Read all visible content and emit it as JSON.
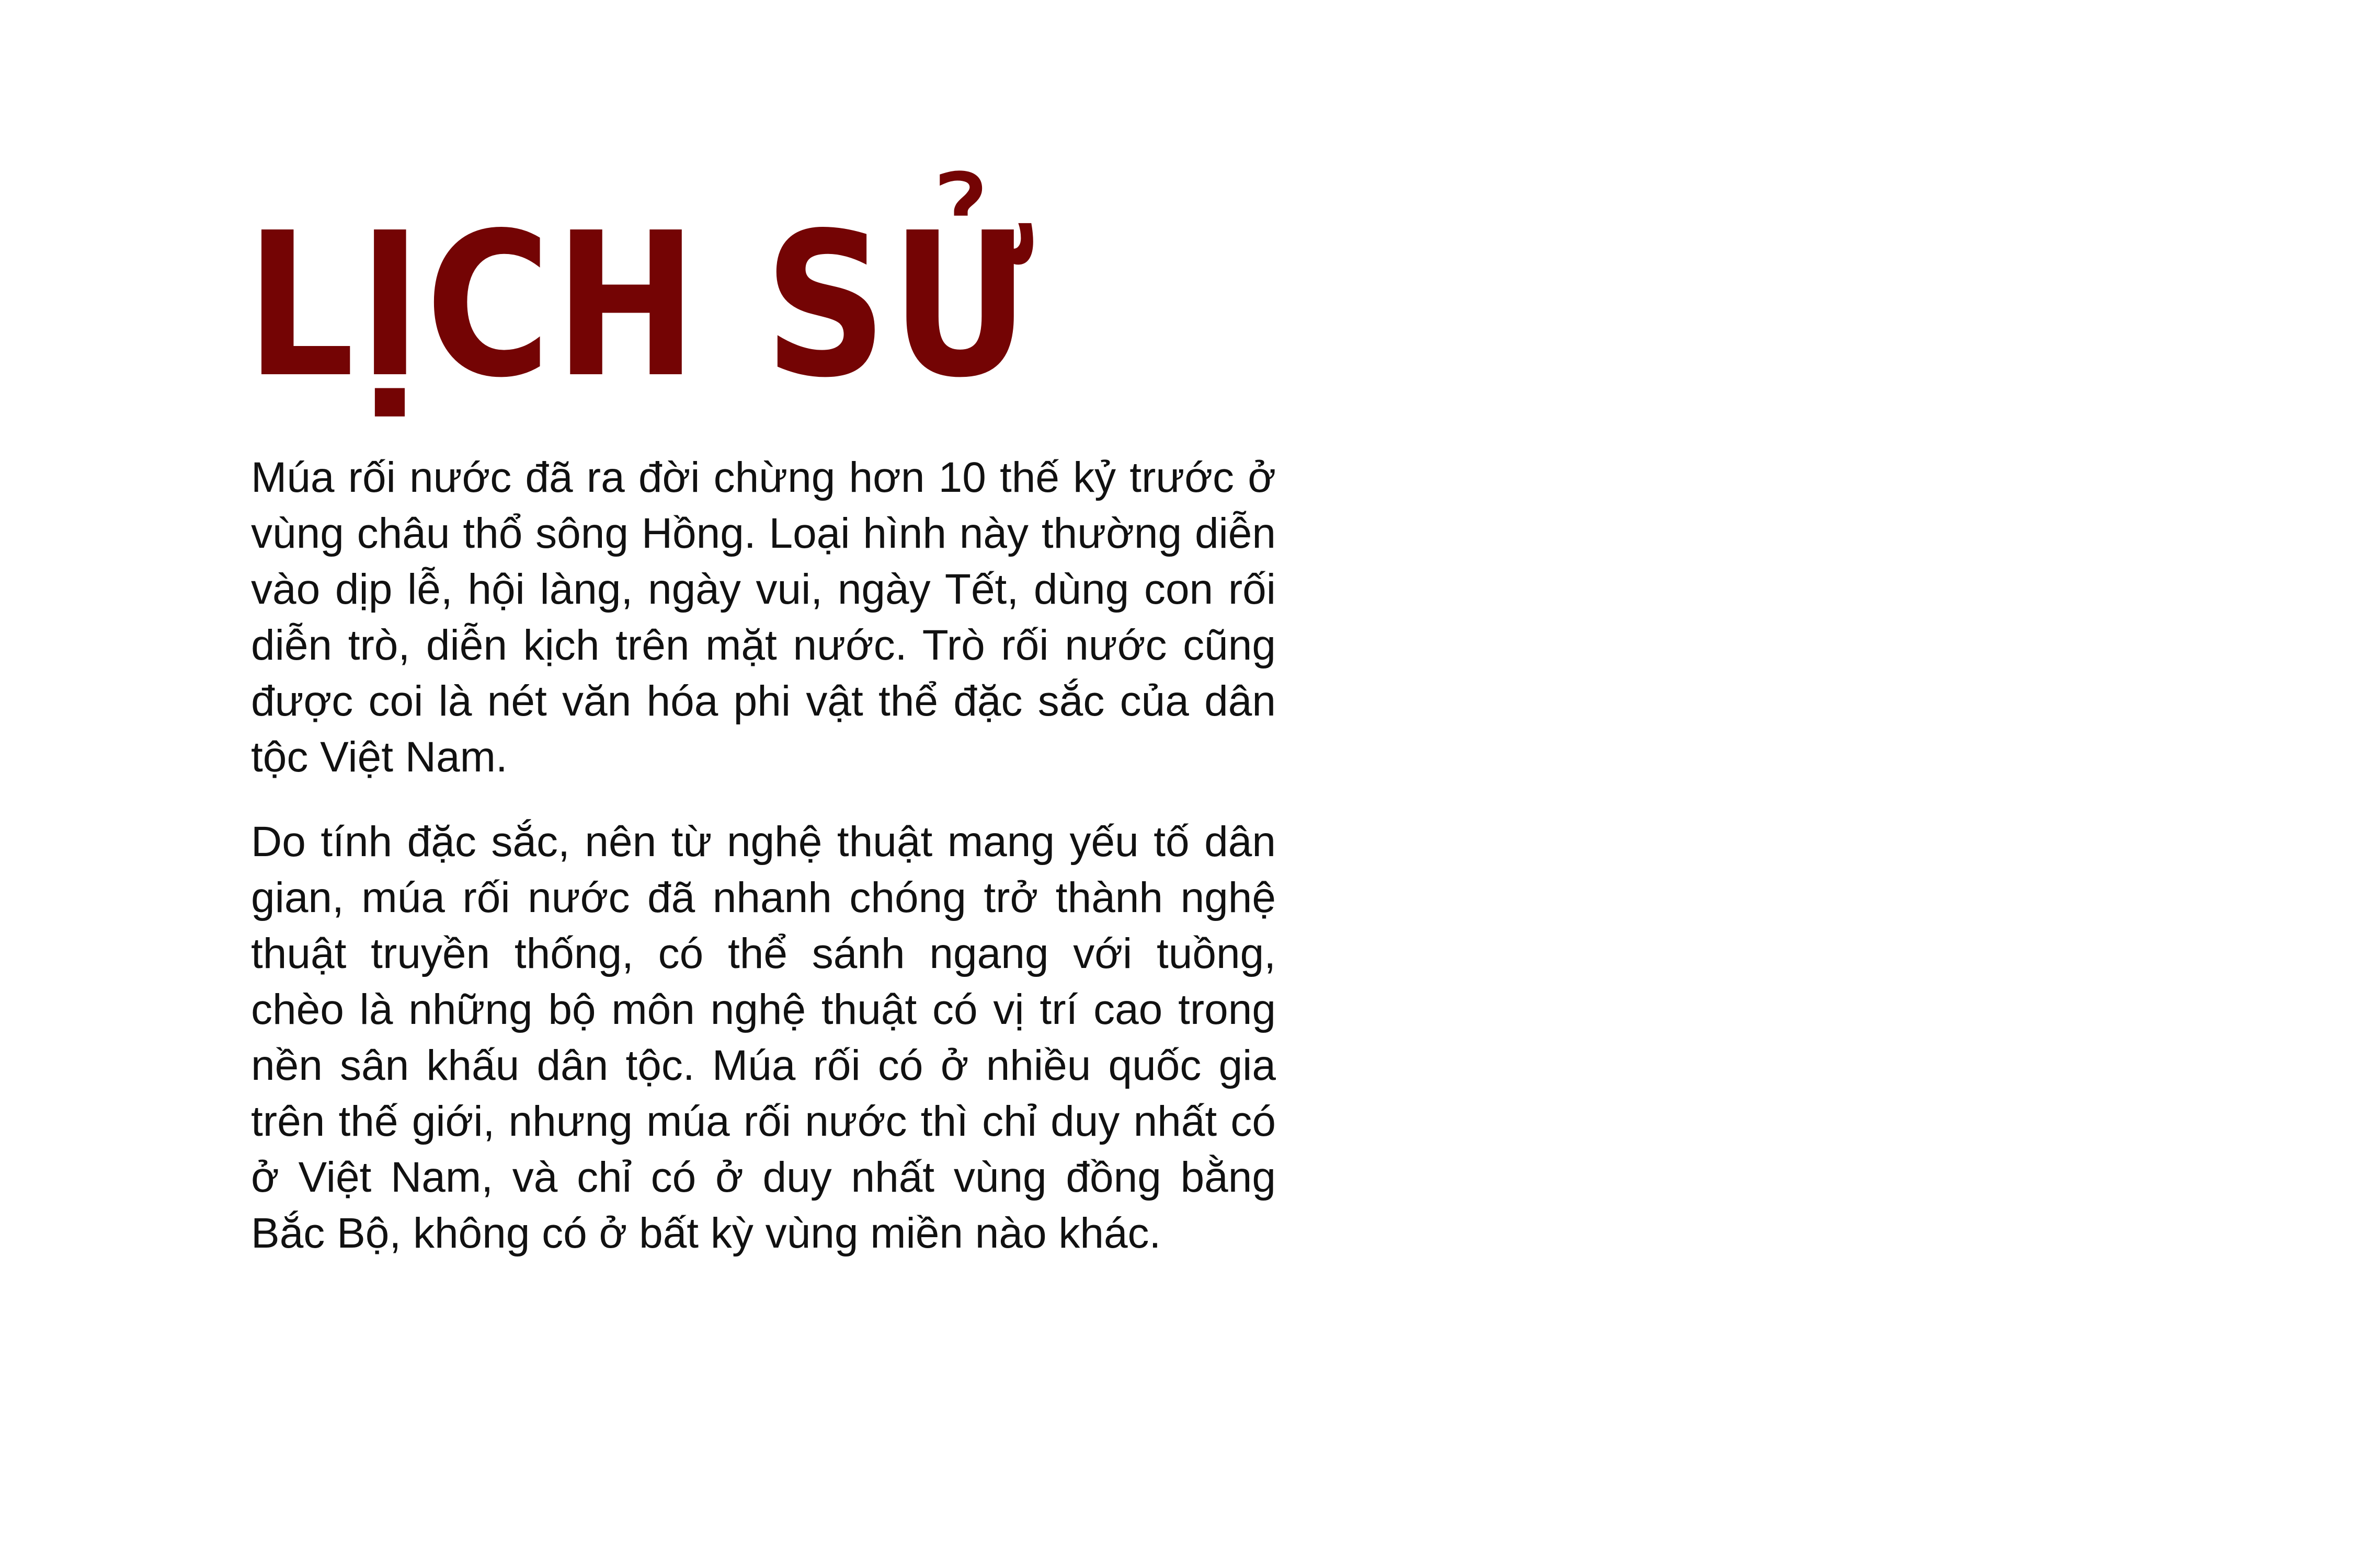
{
  "heading": {
    "title": "LỊCH SỬ"
  },
  "content": {
    "paragraphs": [
      "Múa rối nước đã ra đời chừng hơn 10 thế kỷ trước ở vùng châu thổ sông Hồng. Loại hình này thường diễn vào dịp lễ, hội làng, ngày vui, ngày Tết, dùng con rối diễn trò, diễn kịch trên mặt nước. Trò rối nước cũng được coi là nét văn hóa phi vật thể đặc sắc của dân tộc Việt Nam.",
      "Do tính đặc sắc, nên từ nghệ thuật mang yếu tố dân gian, múa rối nước đã nhanh chóng trở thành nghệ thuật truyền thống, có thể sánh ngang với tuồng, chèo là những bộ môn nghệ thuật có vị trí cao trong nền sân khấu dân tộc. Múa rối có ở nhiều quốc gia trên thế giới, nhưng múa rối nước thì chỉ duy nhất có ở Việt Nam, và chỉ có ở duy nhất vùng đồng bằng Bắc Bộ, không có ở bất kỳ vùng miền nào khác."
    ]
  },
  "colors": {
    "title": "#740404",
    "text": "#111111",
    "background": "#ffffff"
  }
}
